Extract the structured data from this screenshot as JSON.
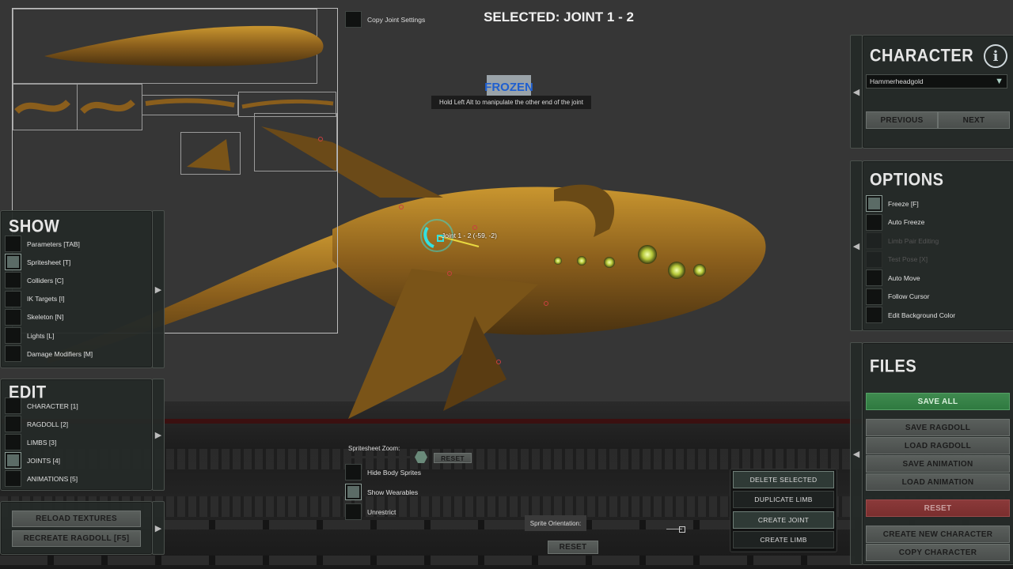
{
  "header": {
    "title": "SELECTED: JOINT 1 - 2",
    "copy_joint_settings": "Copy Joint Settings"
  },
  "frozen": {
    "badge": "FROZEN",
    "hint": "Hold Left Alt to manipulate the other end of the joint"
  },
  "joint_label": "Joint 1 - 2 (-59, -2)",
  "show_panel": {
    "title": "SHOW",
    "items": [
      {
        "label": "Parameters [TAB]",
        "checked": false
      },
      {
        "label": "Spritesheet [T]",
        "checked": true
      },
      {
        "label": "Colliders [C]",
        "checked": false
      },
      {
        "label": "IK Targets [I]",
        "checked": false
      },
      {
        "label": "Skeleton [N]",
        "checked": false
      },
      {
        "label": "Lights [L]",
        "checked": false
      },
      {
        "label": "Damage Modifiers [M]",
        "checked": false
      }
    ]
  },
  "edit_panel": {
    "title": "EDIT",
    "items": [
      {
        "label": "CHARACTER [1]",
        "checked": false
      },
      {
        "label": "RAGDOLL [2]",
        "checked": false
      },
      {
        "label": "LIMBS [3]",
        "checked": false
      },
      {
        "label": "JOINTS [4]",
        "checked": true
      },
      {
        "label": "ANIMATIONS [5]",
        "checked": false
      }
    ]
  },
  "bottom_left": {
    "reload_textures": "RELOAD TEXTURES",
    "recreate_ragdoll": "RECREATE RAGDOLL [F5]"
  },
  "center_controls": {
    "zoom_label": "Spritesheet Zoom:",
    "zoom_reset": "RESET",
    "hide_body_sprites": "Hide Body Sprites",
    "show_wearables": "Show Wearables",
    "unrestrict": "Unrestrict",
    "sprite_orientation": "Sprite Orientation:",
    "orientation_reset": "RESET"
  },
  "limb_buttons": {
    "delete_selected": "DELETE SELECTED",
    "duplicate_limb": "DUPLICATE LIMB",
    "create_joint": "CREATE JOINT",
    "create_limb": "CREATE LIMB"
  },
  "character_panel": {
    "title": "CHARACTER",
    "selected": "Hammerheadgold",
    "previous": "PREVIOUS",
    "next": "NEXT"
  },
  "options_panel": {
    "title": "OPTIONS",
    "items": [
      {
        "label": "Freeze [F]",
        "checked": true,
        "enabled": true
      },
      {
        "label": "Auto Freeze",
        "checked": false,
        "enabled": true
      },
      {
        "label": "Limb Pair Editing",
        "checked": false,
        "enabled": false
      },
      {
        "label": "Test Pose [X]",
        "checked": false,
        "enabled": false
      },
      {
        "label": "Auto Move",
        "checked": false,
        "enabled": true
      },
      {
        "label": "Follow Cursor",
        "checked": false,
        "enabled": true
      },
      {
        "label": "Edit Background Color",
        "checked": false,
        "enabled": true
      }
    ]
  },
  "files_panel": {
    "title": "FILES",
    "save_all": "SAVE ALL",
    "save_ragdoll": "SAVE RAGDOLL",
    "load_ragdoll": "LOAD RAGDOLL",
    "save_animation": "SAVE ANIMATION",
    "load_animation": "LOAD ANIMATION",
    "reset": "RESET",
    "create_new_character": "CREATE NEW CHARACTER",
    "copy_character": "COPY CHARACTER"
  },
  "colors": {
    "panel_bg": "#252a28",
    "save_green": "#2f7a40",
    "reset_red": "#7a2e2e",
    "joint_cyan": "#33e0e0",
    "creature_gold": "#b8862a"
  }
}
